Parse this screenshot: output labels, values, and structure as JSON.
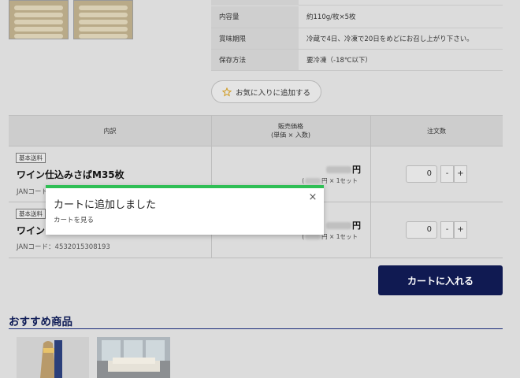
{
  "spec": {
    "rows": [
      {
        "key": "内容量",
        "value": "約110g/枚×5枚"
      },
      {
        "key": "賞味期限",
        "value": "冷蔵で4日、冷凍で20日をめどにお召し上がり下さい。"
      },
      {
        "key": "保存方法",
        "value": "要冷凍（-18℃以下）"
      }
    ]
  },
  "favorite": {
    "label": "お気に入りに追加する",
    "icon": "star-icon"
  },
  "order_table": {
    "headers": {
      "item": "内訳",
      "price": "販売価格",
      "price_sub": "(単価 × 入数)",
      "qty": "注文数"
    },
    "rows": [
      {
        "tag": "基本送料",
        "name": "ワイン仕込みさばM35枚",
        "jan": "JANコード：",
        "price_suffix": "円",
        "unit_suffix": "円 × 1セット",
        "qty": "0"
      },
      {
        "tag": "基本送料",
        "name": "ワイン",
        "jan": "JANコード：4532015308193",
        "price_suffix": "円",
        "unit_suffix": "円 × 1セット",
        "qty": "0"
      }
    ],
    "minus_label": "-",
    "plus_label": "+"
  },
  "cart_button": {
    "label": "カートに入れる"
  },
  "recommended": {
    "title": "おすすめ商品"
  },
  "toast": {
    "title": "カートに追加しました",
    "link": "カートを見る",
    "close": "×",
    "accent_color": "#2fbf55"
  },
  "colors": {
    "brand_navy": "#101a52",
    "overlay": "#dcdcdc"
  }
}
